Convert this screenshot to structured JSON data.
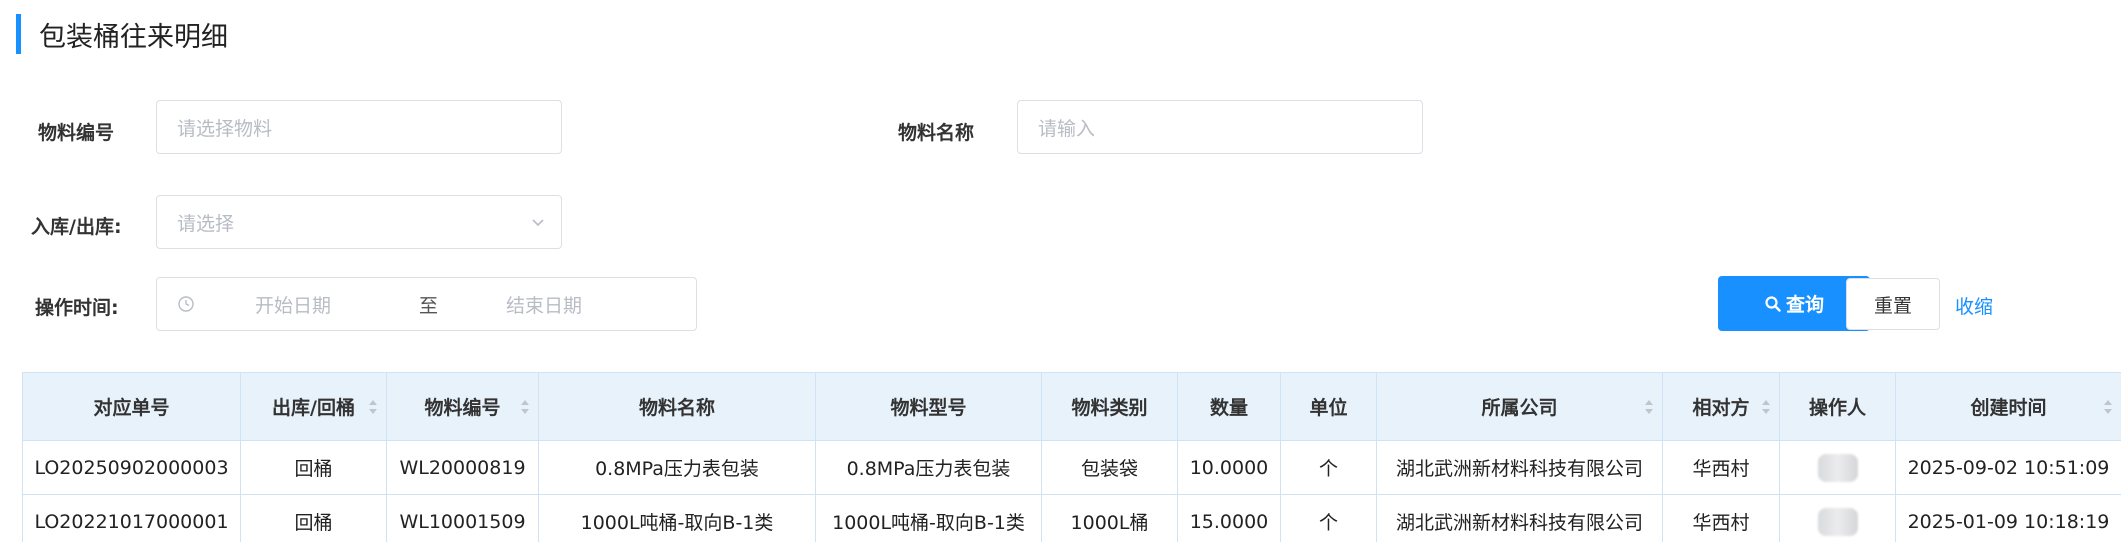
{
  "page": {
    "title": "包装桶往来明细"
  },
  "filters": {
    "material_code": {
      "label": "物料编号",
      "placeholder": "请选择物料"
    },
    "material_name": {
      "label": "物料名称",
      "placeholder": "请输入"
    },
    "in_out": {
      "label": "入库/出库:",
      "placeholder": "请选择"
    },
    "op_time": {
      "label": "操作时间:",
      "start_placeholder": "开始日期",
      "separator": "至",
      "end_placeholder": "结束日期"
    }
  },
  "actions": {
    "query_label": "查询",
    "reset_label": "重置",
    "collapse_label": "收缩"
  },
  "colors": {
    "accent": "#1890ff",
    "header_bg": "#e8f2fb",
    "border": "#cfe3f4"
  },
  "table": {
    "columns": [
      "对应单号",
      "出库/回桶",
      "物料编号",
      "物料名称",
      "物料型号",
      "物料类别",
      "数量",
      "单位",
      "所属公司",
      "相对方",
      "操作人",
      "创建时间"
    ],
    "rows": [
      [
        "LO20250902000003",
        "回桶",
        "WL20000819",
        "0.8MPa压力表包装",
        "0.8MPa压力表包装",
        "包装袋",
        "10.0000",
        "个",
        "湖北武洲新材料科技有限公司",
        "华西村",
        "",
        "2025-09-02 10:51:09"
      ],
      [
        "LO20221017000001",
        "回桶",
        "WL10001509",
        "1000L吨桶-取向B-1类",
        "1000L吨桶-取向B-1类",
        "1000L桶",
        "15.0000",
        "个",
        "湖北武洲新材料科技有限公司",
        "华西村",
        "",
        "2025-01-09 10:18:19"
      ]
    ]
  }
}
